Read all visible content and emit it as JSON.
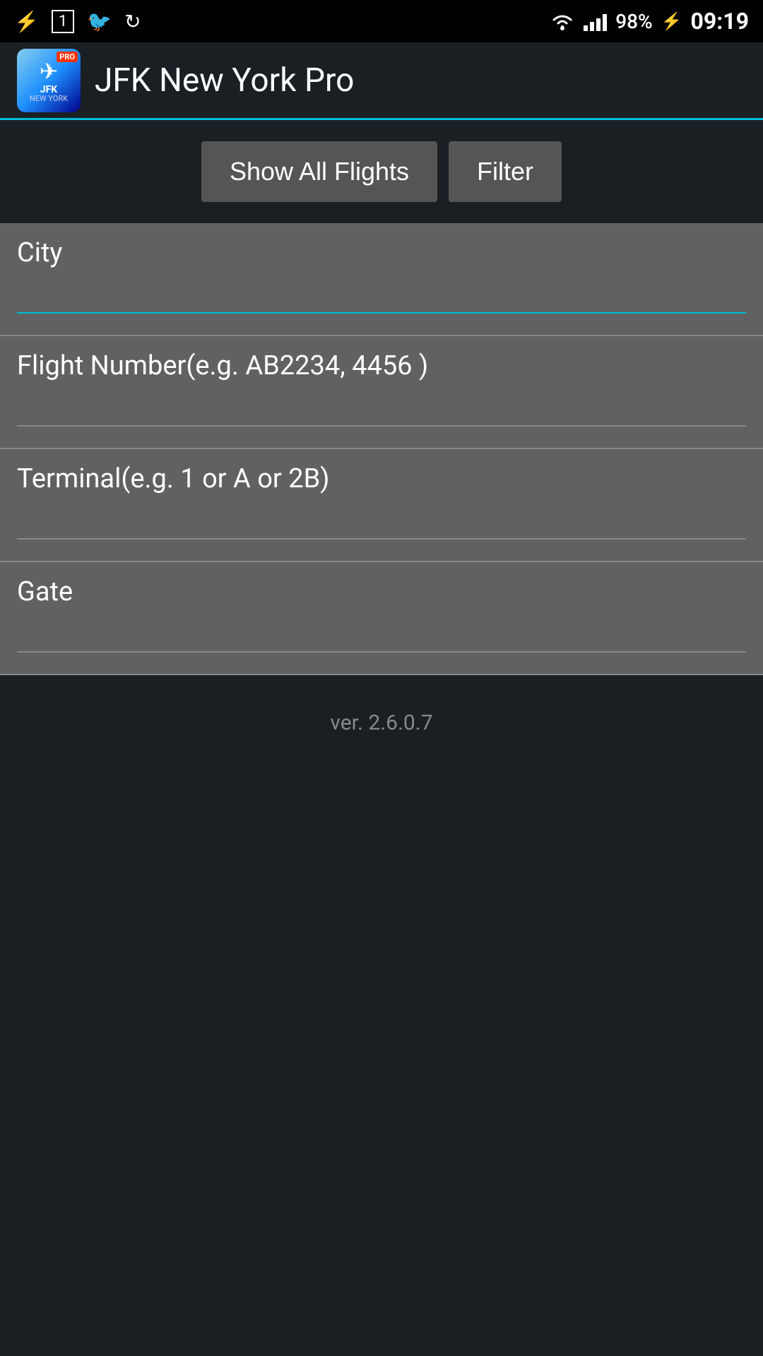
{
  "statusBar": {
    "time": "09:19",
    "battery": "98%",
    "icons": {
      "usb": "⚡",
      "screen": "1",
      "twitterbird": "🐦",
      "refresh": "🔄",
      "wifi": "wifi",
      "signal": "signal",
      "battery_lightning": "⚡"
    }
  },
  "header": {
    "appTitle": "JFK New York Pro",
    "logo": {
      "plane": "✈",
      "text": "JFK",
      "subtext": "NEW YORK",
      "badge": "PRO"
    }
  },
  "buttons": {
    "showAllFlights": "Show All Flights",
    "filter": "Filter"
  },
  "fields": [
    {
      "id": "city",
      "label": "City",
      "placeholder": ""
    },
    {
      "id": "flight-number",
      "label": "Flight Number(e.g. AB2234, 4456 )",
      "placeholder": ""
    },
    {
      "id": "terminal",
      "label": "Terminal(e.g. 1 or A or 2B)",
      "placeholder": ""
    },
    {
      "id": "gate",
      "label": "Gate",
      "placeholder": ""
    }
  ],
  "version": "ver. 2.6.0.7"
}
